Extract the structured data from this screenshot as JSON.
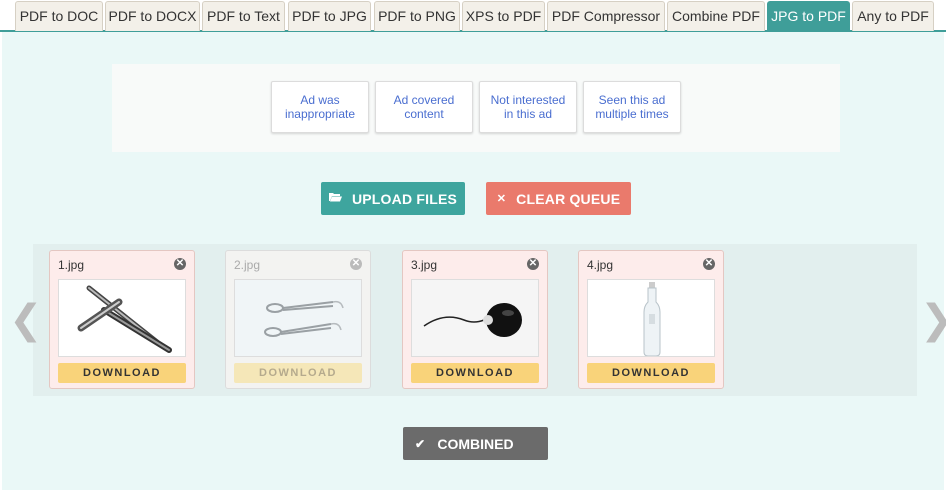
{
  "tabs": [
    {
      "label": "PDF to DOC"
    },
    {
      "label": "PDF to DOCX"
    },
    {
      "label": "PDF to Text"
    },
    {
      "label": "PDF to JPG"
    },
    {
      "label": "PDF to PNG"
    },
    {
      "label": "XPS to PDF"
    },
    {
      "label": "PDF Compressor"
    },
    {
      "label": "Combine PDF"
    },
    {
      "label": "JPG to PDF",
      "active": true
    },
    {
      "label": "Any to PDF"
    }
  ],
  "ad_feedback": {
    "options": [
      "Ad was inappropriate",
      "Ad covered content",
      "Not interested in this ad",
      "Seen this ad multiple times"
    ]
  },
  "actions": {
    "upload_label": "UPLOAD FILES",
    "clear_label": "CLEAR QUEUE"
  },
  "queue": {
    "files": [
      {
        "name": "1.jpg",
        "download_label": "DOWNLOAD",
        "image": "pens",
        "dimmed": false
      },
      {
        "name": "2.jpg",
        "download_label": "DOWNLOAD",
        "image": "hair-clips",
        "dimmed": true
      },
      {
        "name": "3.jpg",
        "download_label": "DOWNLOAD",
        "image": "computer-mouse",
        "dimmed": false
      },
      {
        "name": "4.jpg",
        "download_label": "DOWNLOAD",
        "image": "water-bottle",
        "dimmed": false
      }
    ]
  },
  "combined_label": "COMBINED",
  "colors": {
    "accent": "#3f9e99",
    "upload": "#3ea59e",
    "clear": "#ea7a6c",
    "download": "#f9d37a",
    "combined": "#6b6b6b"
  }
}
